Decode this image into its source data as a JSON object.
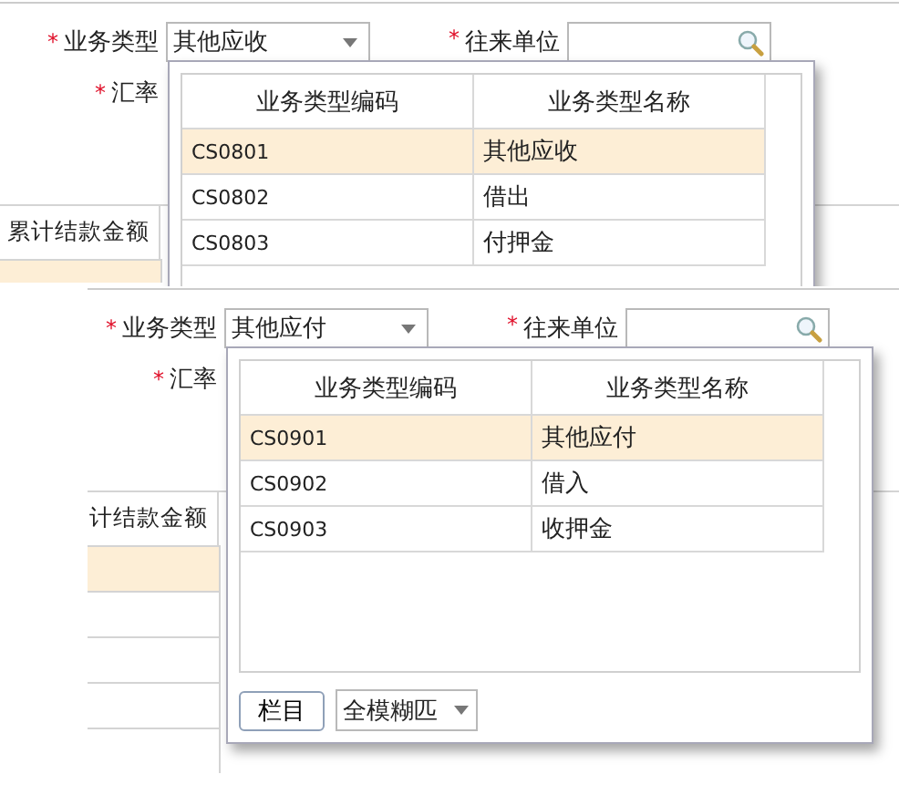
{
  "screens": [
    {
      "form": {
        "business_type_label": "业务类型",
        "business_type_value": "其他应收",
        "partner_label": "往来单位",
        "rate_label": "汇率",
        "required_mark": "*"
      },
      "grid": {
        "column_header": "累计结款金额",
        "rows": [
          {
            "selected": true
          }
        ]
      },
      "dropdown": {
        "columns": [
          "业务类型编码",
          "业务类型名称"
        ],
        "rows": [
          {
            "code": "CS0801",
            "name": "其他应收",
            "selected": true
          },
          {
            "code": "CS0802",
            "name": "借出",
            "selected": false
          },
          {
            "code": "CS0803",
            "name": "付押金",
            "selected": false
          }
        ]
      }
    },
    {
      "form": {
        "business_type_label": "业务类型",
        "business_type_value": "其他应付",
        "partner_label": "往来单位",
        "rate_label": "汇率",
        "required_mark": "*"
      },
      "grid": {
        "column_header": "计结款金额",
        "rows": [
          {
            "selected": true
          },
          {
            "selected": false
          },
          {
            "selected": false
          },
          {
            "selected": false
          },
          {
            "selected": false
          }
        ]
      },
      "dropdown": {
        "columns": [
          "业务类型编码",
          "业务类型名称"
        ],
        "rows": [
          {
            "code": "CS0901",
            "name": "其他应付",
            "selected": true
          },
          {
            "code": "CS0902",
            "name": "借入",
            "selected": false
          },
          {
            "code": "CS0903",
            "name": "收押金",
            "selected": false
          }
        ],
        "footer": {
          "columns_button": "栏目",
          "match_mode": "全模糊匹"
        }
      }
    }
  ]
}
